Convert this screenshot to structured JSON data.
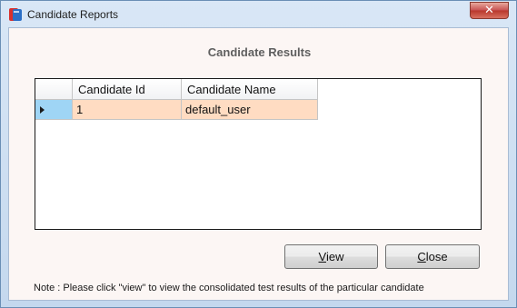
{
  "window": {
    "title": "Candidate Reports",
    "app_icon": "app-icon",
    "close_icon": "close-icon"
  },
  "main": {
    "heading": "Candidate Results",
    "grid": {
      "columns": [
        "Candidate Id",
        "Candidate Name"
      ],
      "rows": [
        {
          "id": "1",
          "name": "default_user",
          "selected": true
        }
      ],
      "row_header_icon": "row-pointer-icon"
    },
    "buttons": {
      "view": {
        "mnemonic": "V",
        "rest": "iew"
      },
      "close": {
        "mnemonic": "C",
        "rest": "lose"
      }
    },
    "note": "Note : Please click \"view\" to view the consolidated test results of the particular candidate"
  },
  "colors": {
    "selected_row": "#ffdcc2",
    "row_header_selected": "#9fd5f5",
    "close_button": "#c75050",
    "client_bg": "#fcf6f4"
  }
}
